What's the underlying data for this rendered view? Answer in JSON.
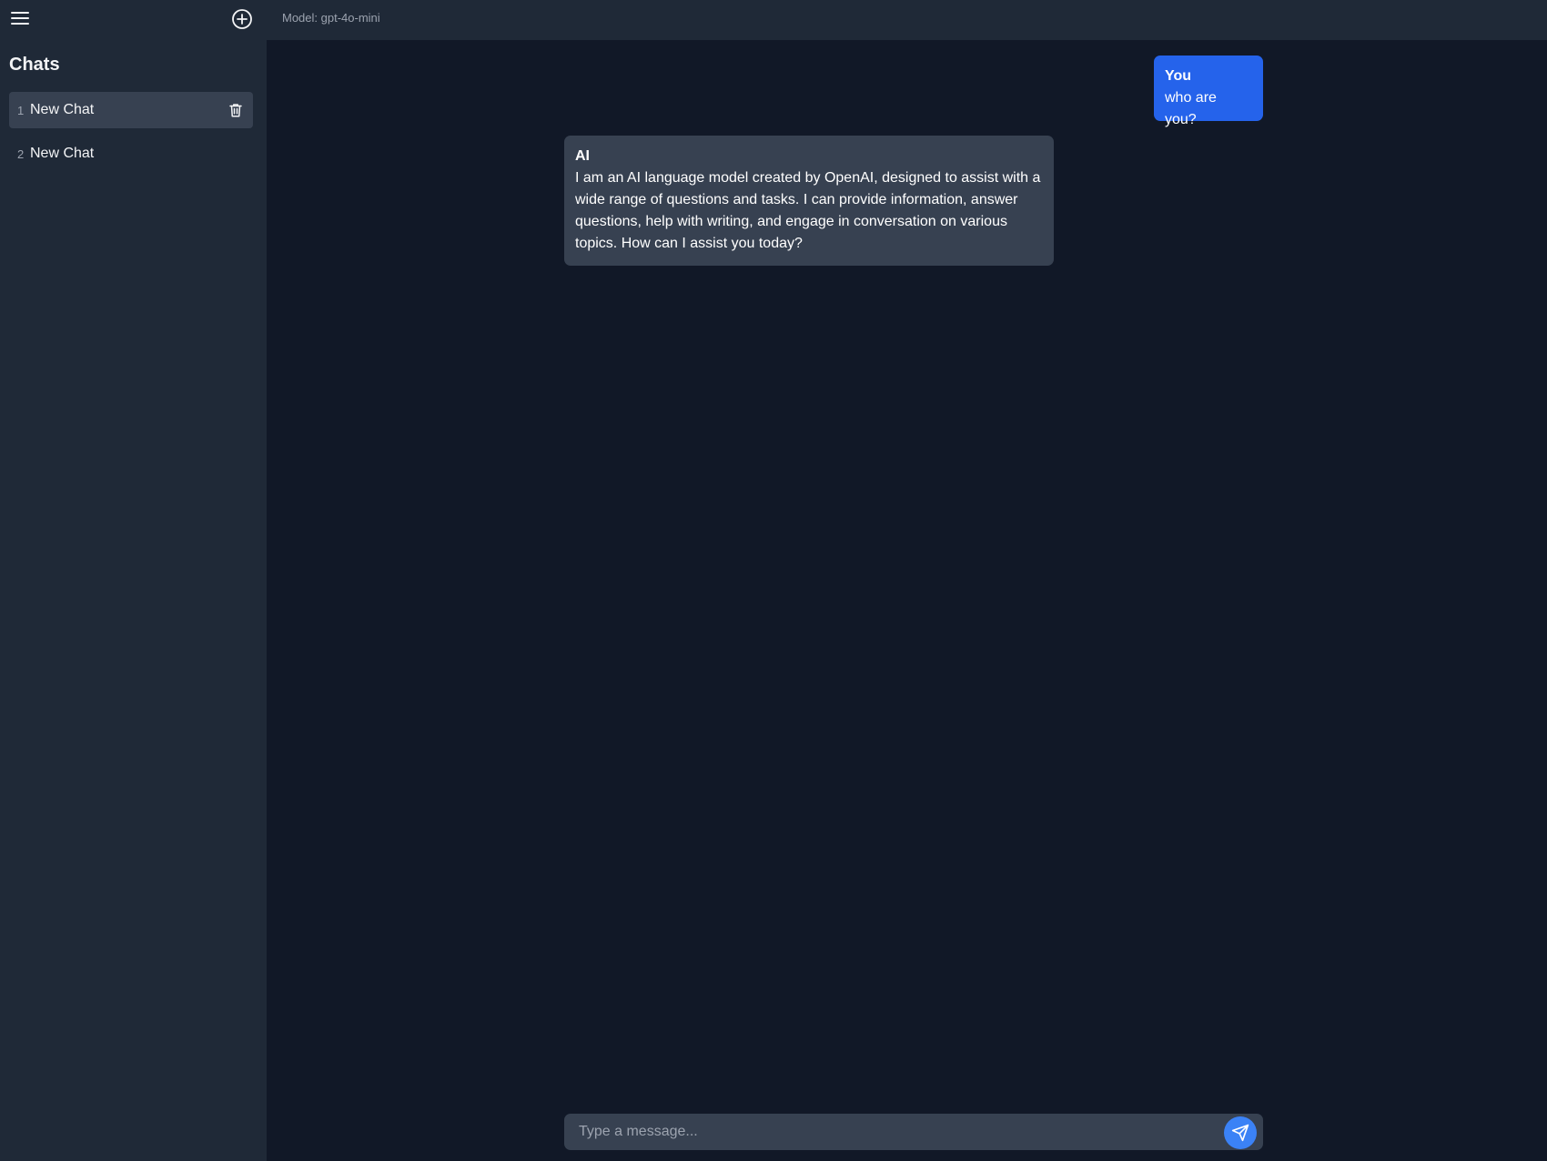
{
  "header": {
    "model_label": "Model: gpt-4o-mini"
  },
  "sidebar": {
    "heading": "Chats",
    "items": [
      {
        "index": "1",
        "title": "New Chat",
        "active": true
      },
      {
        "index": "2",
        "title": "New Chat",
        "active": false
      }
    ]
  },
  "messages": [
    {
      "author": "You",
      "text": "who are you?"
    },
    {
      "author": "AI",
      "text": "I am an AI language model created by OpenAI, designed to assist with a wide range of questions and tasks. I can provide information, answer questions, help with writing, and engage in conversation on various topics. How can I assist you today?"
    }
  ],
  "composer": {
    "placeholder": "Type a message...",
    "value": ""
  },
  "icons": {
    "menu": "hamburger-menu-icon",
    "new_chat": "plus-circle-icon",
    "delete": "trash-icon",
    "send": "paper-plane-icon"
  },
  "colors": {
    "background": "#111827",
    "sidebar": "#1f2937",
    "user_bubble": "#2563eb",
    "ai_bubble": "#374151",
    "send_button": "#3b82f6"
  }
}
